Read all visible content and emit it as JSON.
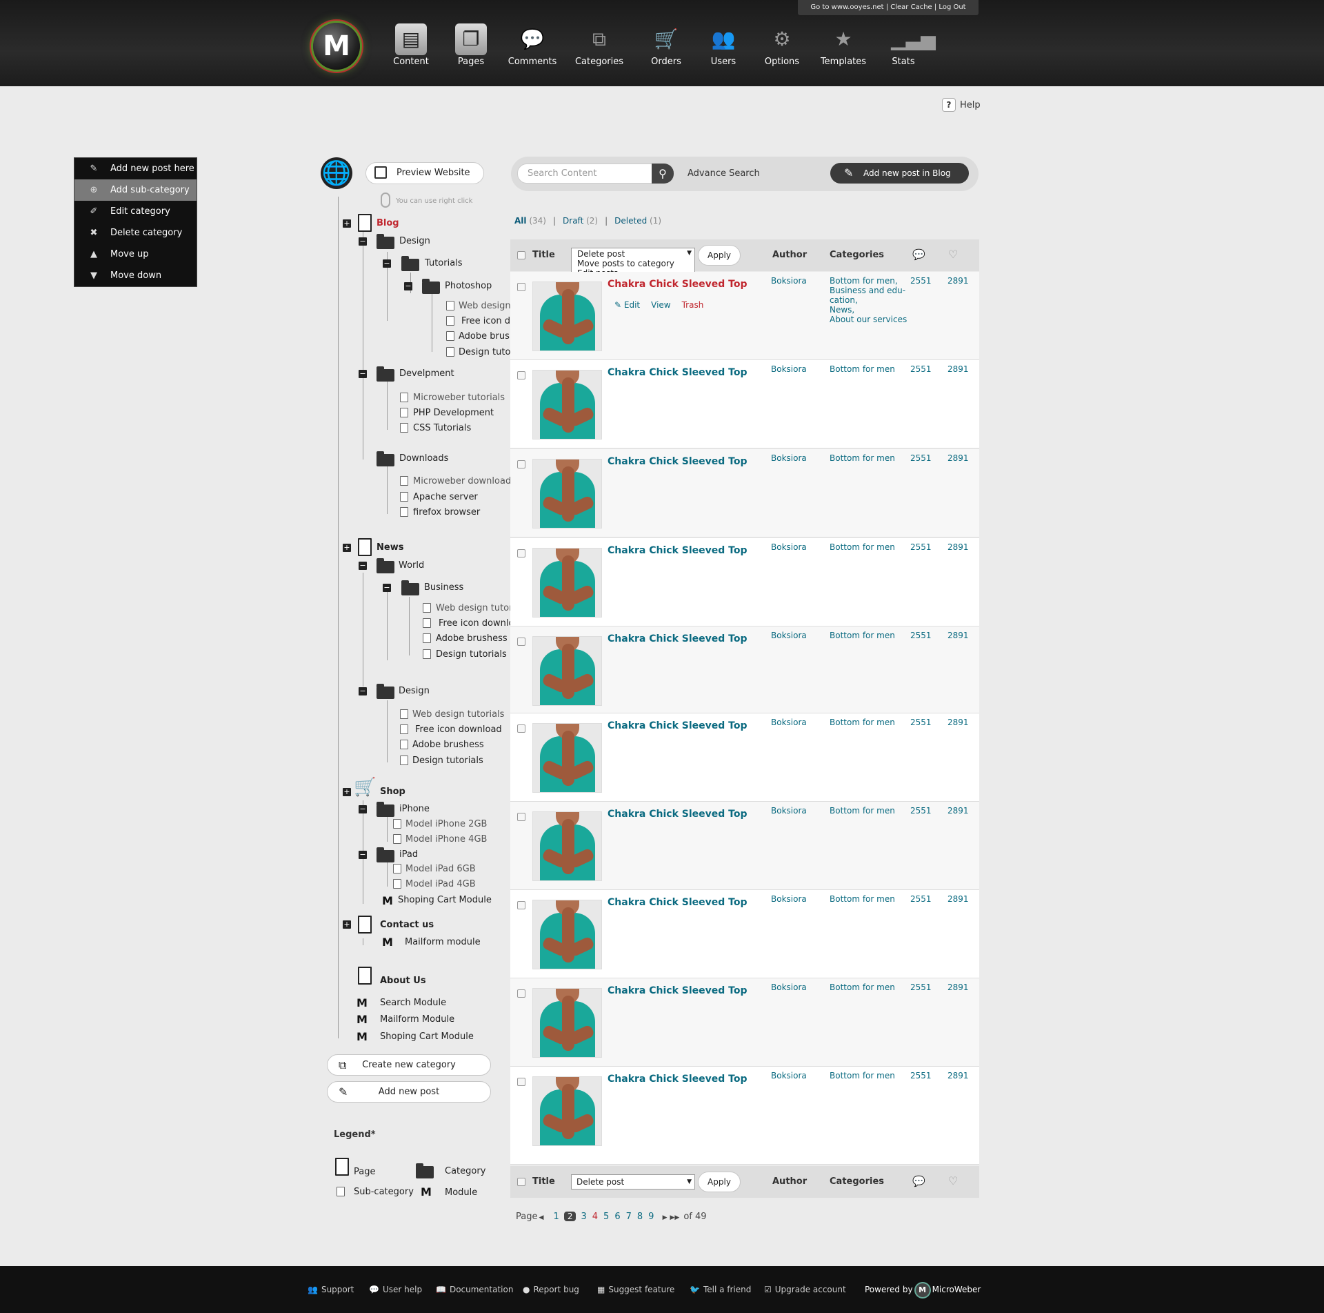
{
  "topbar": {
    "links": "Go to www.ooyes.net  |  Clear Cache | Log Out",
    "logo": "M",
    "nav": [
      {
        "label": "Content",
        "icon": "content-icon"
      },
      {
        "label": "Pages",
        "icon": "pages-icon"
      },
      {
        "label": "Comments",
        "icon": "comments-icon"
      },
      {
        "label": "Categories",
        "icon": "categories-icon"
      },
      {
        "label": "Orders",
        "icon": "cart-icon"
      },
      {
        "label": "Users",
        "icon": "users-icon"
      },
      {
        "label": "Options",
        "icon": "gear-icon"
      },
      {
        "label": "Templates",
        "icon": "star-icon"
      },
      {
        "label": "Stats",
        "icon": "stats-icon"
      }
    ]
  },
  "help": "Help",
  "context_menu": [
    {
      "label": "Add new post here",
      "icon": "pencil-icon"
    },
    {
      "label": "Add sub-category",
      "icon": "add-category-icon"
    },
    {
      "label": "Edit category",
      "icon": "edit-category-icon"
    },
    {
      "label": "Delete category",
      "icon": "delete-category-icon"
    },
    {
      "label": "Move up",
      "icon": "arrow-up-icon"
    },
    {
      "label": "Move down",
      "icon": "arrow-down-icon"
    }
  ],
  "tree": {
    "preview_label": "Preview Website",
    "right_click_hint": "You can use right click",
    "blog": "Blog",
    "blog_design": "Design",
    "tutorials": "Tutorials",
    "photoshop": "Photoshop",
    "web_design_tutorials": "Web design tutorials",
    "free_icon_download": "Free icon  download",
    "adobe_brushess": "Adobe brushess",
    "design_tutorials": "Design tutorials",
    "develpment": "Develpment",
    "microweber_tutorials": "Microweber tutorials",
    "php_development": "PHP Development",
    "css_tutorials": "CSS Tutorials",
    "downloads": "Downloads",
    "microweber_download": "Microweber download",
    "apache_server": "Apache server",
    "firefox_browser": "firefox browser",
    "news": "News",
    "world": "World",
    "business": "Business",
    "design": "Design",
    "shop": "Shop",
    "iphone": "iPhone",
    "model_iphone_2gb": "Model iPhone 2GB",
    "model_iphone_4gb": "Model iPhone 4GB",
    "ipad": "iPad",
    "model_ipad_6gb": "Model iPad 6GB",
    "model_ipad_4gb": "Model iPad 4GB",
    "shoping_cart_module": "Shoping Cart Module",
    "contact_us": "Contact us",
    "mailform_module_lower": "Mailform module",
    "about_us": "About Us",
    "search_module": "Search Module",
    "mailform_module": "Mailform Module",
    "shoping_cart_module_2": "Shoping Cart Module",
    "module_letter": "M",
    "create_category": "Create new category",
    "add_post": "Add new post"
  },
  "legend": {
    "title": "Legend*",
    "page": "Page",
    "category": "Category",
    "sub_category": "Sub-category",
    "module": "Module"
  },
  "search": {
    "placeholder": "Search Content",
    "advanced": "Advance Search",
    "add_post_button": "Add new post in Blog"
  },
  "filters": {
    "all": "All",
    "all_count": "(34)",
    "draft": "Draft",
    "draft_count": "(2)",
    "deleted": "Deleted",
    "deleted_count": "(1)",
    "separator": "|"
  },
  "table": {
    "title_header": "Title",
    "author_header": "Author",
    "categories_header": "Categories",
    "bulk_action_selected": "Delete post",
    "bulk_options": [
      "Delete post",
      "Move posts to category",
      "Edit posts"
    ],
    "apply": "Apply",
    "row_actions": {
      "edit": "Edit",
      "view": "View",
      "trash": "Trash"
    },
    "rows": [
      {
        "title": "Chakra Chick Sleeved Top",
        "author": "Boksiora",
        "categories": "Bottom for men,\nBusiness and edu-\ncation,\nNews,\nAbout our services",
        "comments": "2551",
        "likes": "2891"
      },
      {
        "title": "Chakra Chick Sleeved Top",
        "author": "Boksiora",
        "categories": "Bottom for men",
        "comments": "2551",
        "likes": "2891"
      },
      {
        "title": "Chakra Chick Sleeved Top",
        "author": "Boksiora",
        "categories": "Bottom for men",
        "comments": "2551",
        "likes": "2891"
      },
      {
        "title": "Chakra Chick Sleeved Top",
        "author": "Boksiora",
        "categories": "Bottom for men",
        "comments": "2551",
        "likes": "2891"
      },
      {
        "title": "Chakra Chick Sleeved Top",
        "author": "Boksiora",
        "categories": "Bottom for men",
        "comments": "2551",
        "likes": "2891"
      },
      {
        "title": "Chakra Chick Sleeved Top",
        "author": "Boksiora",
        "categories": "Bottom for men",
        "comments": "2551",
        "likes": "2891"
      },
      {
        "title": "Chakra Chick Sleeved Top",
        "author": "Boksiora",
        "categories": "Bottom for men",
        "comments": "2551",
        "likes": "2891"
      },
      {
        "title": "Chakra Chick Sleeved Top",
        "author": "Boksiora",
        "categories": "Bottom for men",
        "comments": "2551",
        "likes": "2891"
      },
      {
        "title": "Chakra Chick Sleeved Top",
        "author": "Boksiora",
        "categories": "Bottom for men",
        "comments": "2551",
        "likes": "2891"
      },
      {
        "title": "Chakra Chick Sleeved Top",
        "author": "Boksiora",
        "categories": "Bottom for men",
        "comments": "2551",
        "likes": "2891"
      }
    ]
  },
  "pager": {
    "label": "Page",
    "pages": [
      "1",
      "2",
      "3",
      "4",
      "5",
      "6",
      "7",
      "8",
      "9"
    ],
    "current": "2",
    "of": "of 49"
  },
  "footer": {
    "links": [
      {
        "label": "Support",
        "icon": "support-icon"
      },
      {
        "label": "User help",
        "icon": "user-help-icon"
      },
      {
        "label": "Documentation",
        "icon": "documentation-icon"
      },
      {
        "label": "Report bug",
        "icon": "bug-icon"
      },
      {
        "label": "Suggest feature",
        "icon": "suggest-icon"
      },
      {
        "label": "Tell a friend",
        "icon": "bird-icon"
      },
      {
        "label": "Upgrade account",
        "icon": "upgrade-icon"
      }
    ],
    "powered_by": "Powered by",
    "brand": "MicroWeber"
  }
}
